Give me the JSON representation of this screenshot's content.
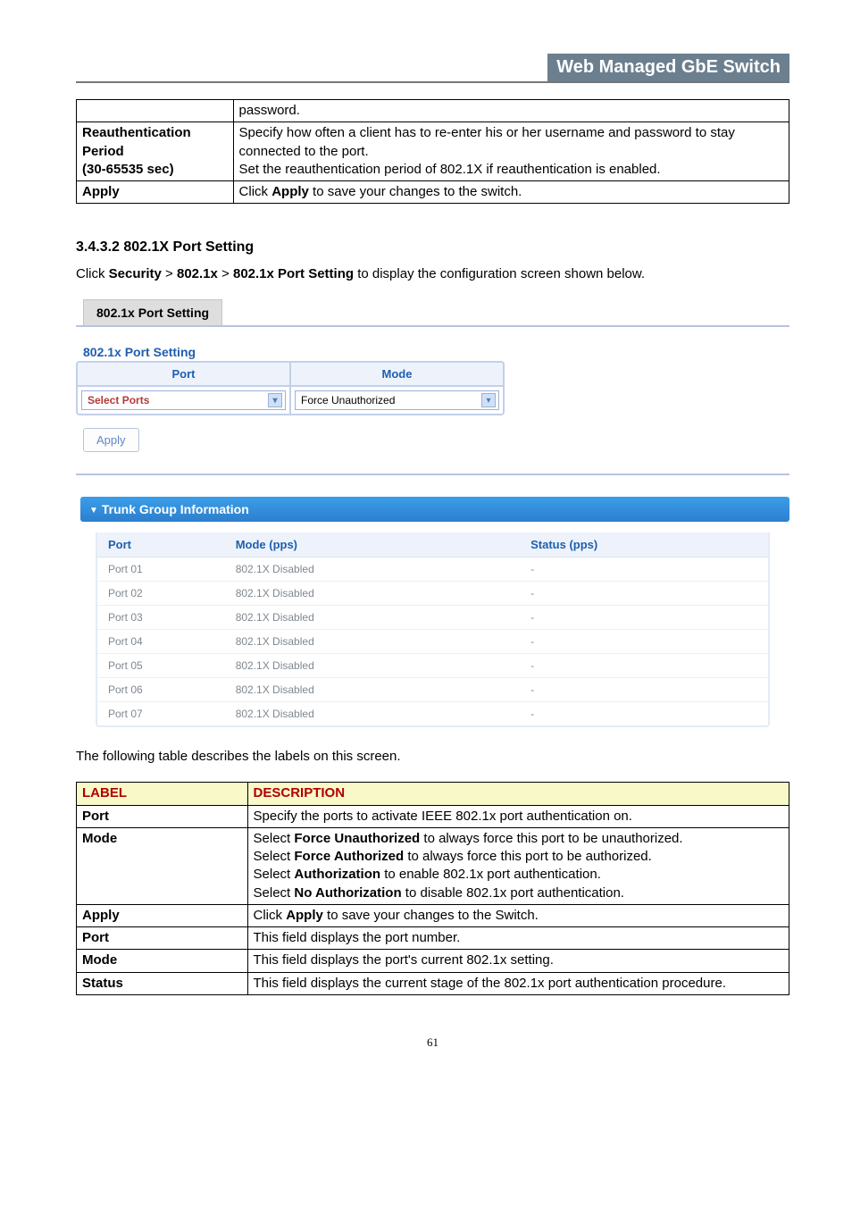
{
  "header": {
    "title": "Web Managed GbE Switch"
  },
  "params_table": {
    "rows": [
      {
        "label": "",
        "desc_plain": "password."
      },
      {
        "label": "Reauthentication Period\n(30-65535 sec)",
        "desc_plain": "Specify how often a client has to re-enter his or her username and password to stay connected to the port.\nSet the reauthentication period of 802.1X if reauthentication is enabled."
      },
      {
        "label": "Apply",
        "desc_click": "Click ",
        "desc_bold": "Apply",
        "desc_after": " to save your changes to the switch."
      }
    ]
  },
  "section": {
    "heading": "3.4.3.2 802.1X Port Setting",
    "intro_prefix": "Click ",
    "crumb1": "Security",
    "sep": " > ",
    "crumb2": "802.1x",
    "crumb3": "802.1x Port Setting",
    "intro_suffix": " to display the configuration screen shown below."
  },
  "tab": {
    "label": "802.1x Port Setting"
  },
  "setting": {
    "title": "802.1x Port Setting",
    "col_port": "Port",
    "col_mode": "Mode",
    "port_select": "Select Ports",
    "mode_select": "Force Unauthorized",
    "apply": "Apply"
  },
  "info_panel": {
    "title": "Trunk Group Information",
    "col_port": "Port",
    "col_mode": "Mode (pps)",
    "col_status": "Status (pps)",
    "rows": [
      {
        "port": "Port 01",
        "mode": "802.1X Disabled",
        "status": "-"
      },
      {
        "port": "Port 02",
        "mode": "802.1X Disabled",
        "status": "-"
      },
      {
        "port": "Port 03",
        "mode": "802.1X Disabled",
        "status": "-"
      },
      {
        "port": "Port 04",
        "mode": "802.1X Disabled",
        "status": "-"
      },
      {
        "port": "Port 05",
        "mode": "802.1X Disabled",
        "status": "-"
      },
      {
        "port": "Port 06",
        "mode": "802.1X Disabled",
        "status": "-"
      },
      {
        "port": "Port 07",
        "mode": "802.1X Disabled",
        "status": "-"
      }
    ]
  },
  "desc_intro": "The following table describes the labels on this screen.",
  "desc_table": {
    "h_label": "LABEL",
    "h_desc": "DESCRIPTION",
    "rows": [
      {
        "label": "Port",
        "plain": "Specify the ports to activate IEEE 802.1x port authentication on."
      },
      {
        "label": "Mode",
        "parts": [
          {
            "t": "Select "
          },
          {
            "b": "Force Unauthorized"
          },
          {
            "t": " to always force this port to be unauthorized."
          },
          {
            "br": true
          },
          {
            "t": "Select "
          },
          {
            "b": "Force Authorized"
          },
          {
            "t": " to always force this port to be authorized."
          },
          {
            "br": true
          },
          {
            "t": "Select "
          },
          {
            "b": "Authorization"
          },
          {
            "t": " to enable 802.1x port authentication."
          },
          {
            "br": true
          },
          {
            "t": "Select "
          },
          {
            "b": "No Authorization"
          },
          {
            "t": " to disable 802.1x port authentication."
          }
        ]
      },
      {
        "label": "Apply",
        "parts": [
          {
            "t": "Click "
          },
          {
            "b": "Apply"
          },
          {
            "t": " to save your changes to the Switch."
          }
        ]
      },
      {
        "label": "Port",
        "plain": "This field displays the port number."
      },
      {
        "label": "Mode",
        "plain": "This field displays the port's current 802.1x setting."
      },
      {
        "label": "Status",
        "plain": "This field displays the current stage of the 802.1x port authentication procedure."
      }
    ]
  },
  "page_number": "61"
}
